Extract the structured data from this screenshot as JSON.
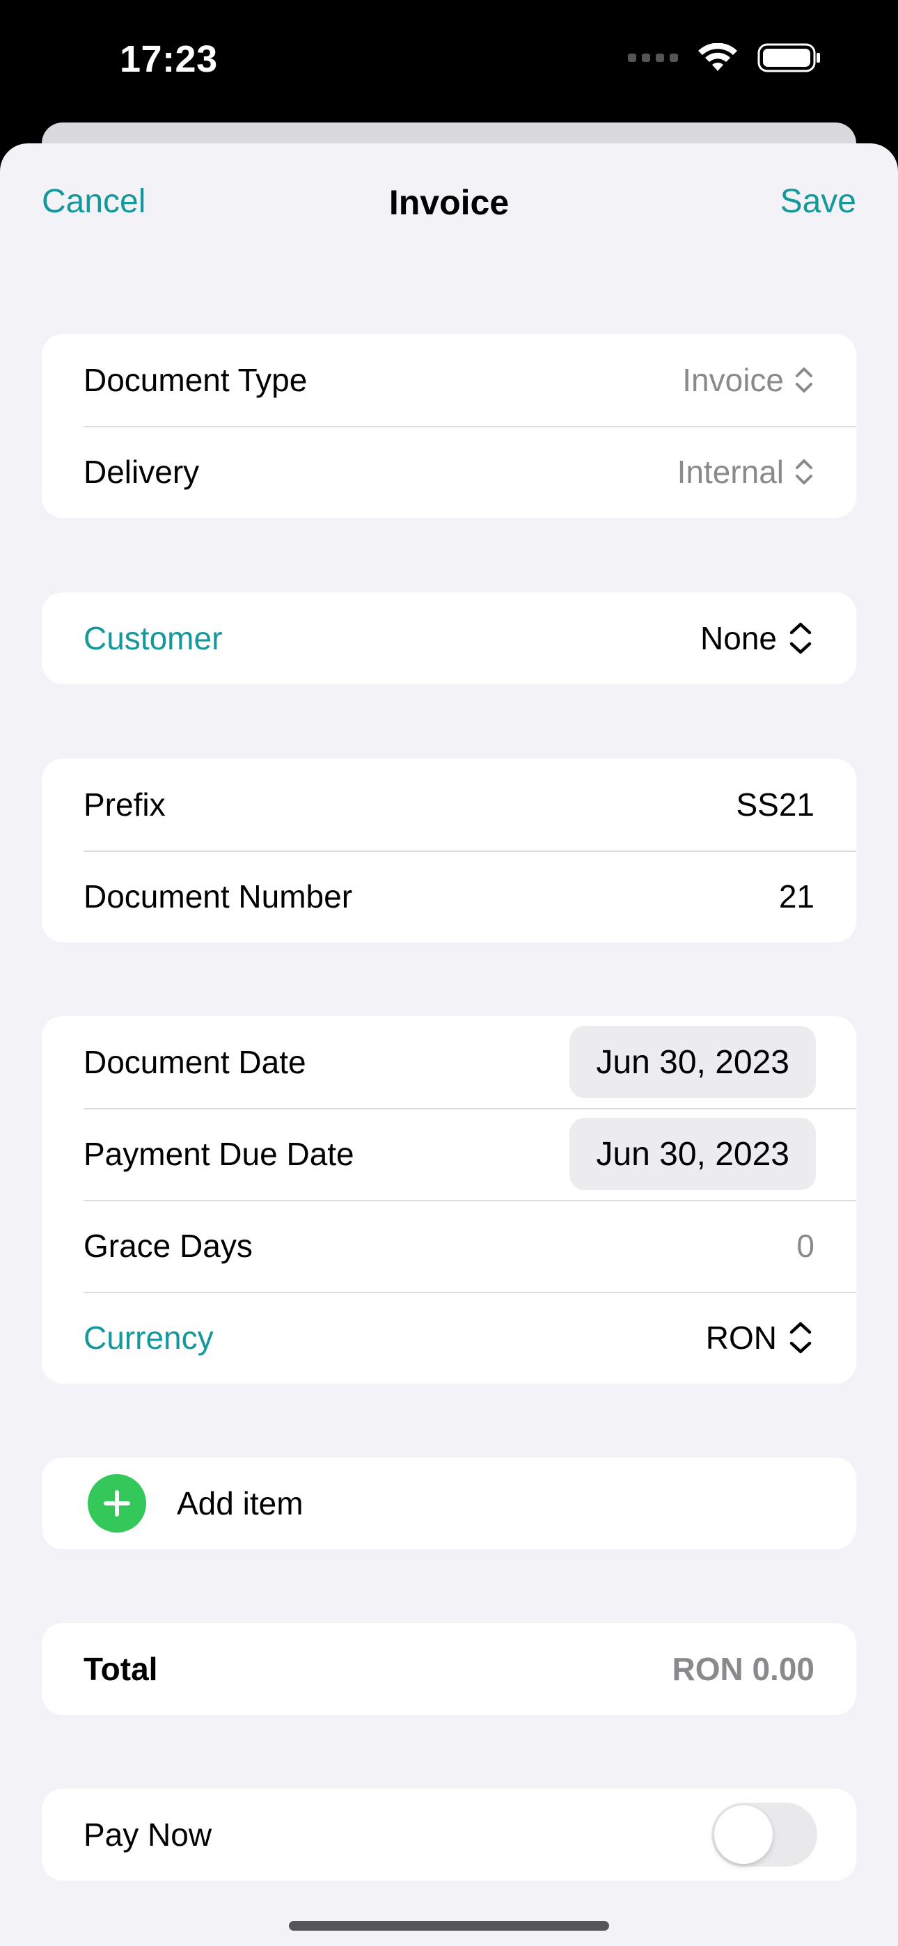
{
  "status_bar": {
    "time": "17:23"
  },
  "nav": {
    "cancel": "Cancel",
    "title": "Invoice",
    "save": "Save"
  },
  "document": {
    "type_label": "Document Type",
    "type_value": "Invoice",
    "delivery_label": "Delivery",
    "delivery_value": "Internal"
  },
  "customer": {
    "label": "Customer",
    "value": "None"
  },
  "numbering": {
    "prefix_label": "Prefix",
    "prefix_value": "SS21",
    "number_label": "Document Number",
    "number_value": "21"
  },
  "dates": {
    "document_date_label": "Document Date",
    "document_date_value": "Jun 30, 2023",
    "due_date_label": "Payment Due Date",
    "due_date_value": "Jun 30, 2023",
    "grace_label": "Grace Days",
    "grace_value": "0",
    "currency_label": "Currency",
    "currency_value": "RON"
  },
  "items": {
    "add_label": "Add item"
  },
  "total": {
    "label": "Total",
    "value": "RON 0.00"
  },
  "payment": {
    "pay_now_label": "Pay Now",
    "pay_now_on": false
  },
  "colors": {
    "accent": "#14989b",
    "add_green": "#34c759",
    "background": "#f2f2f7"
  }
}
